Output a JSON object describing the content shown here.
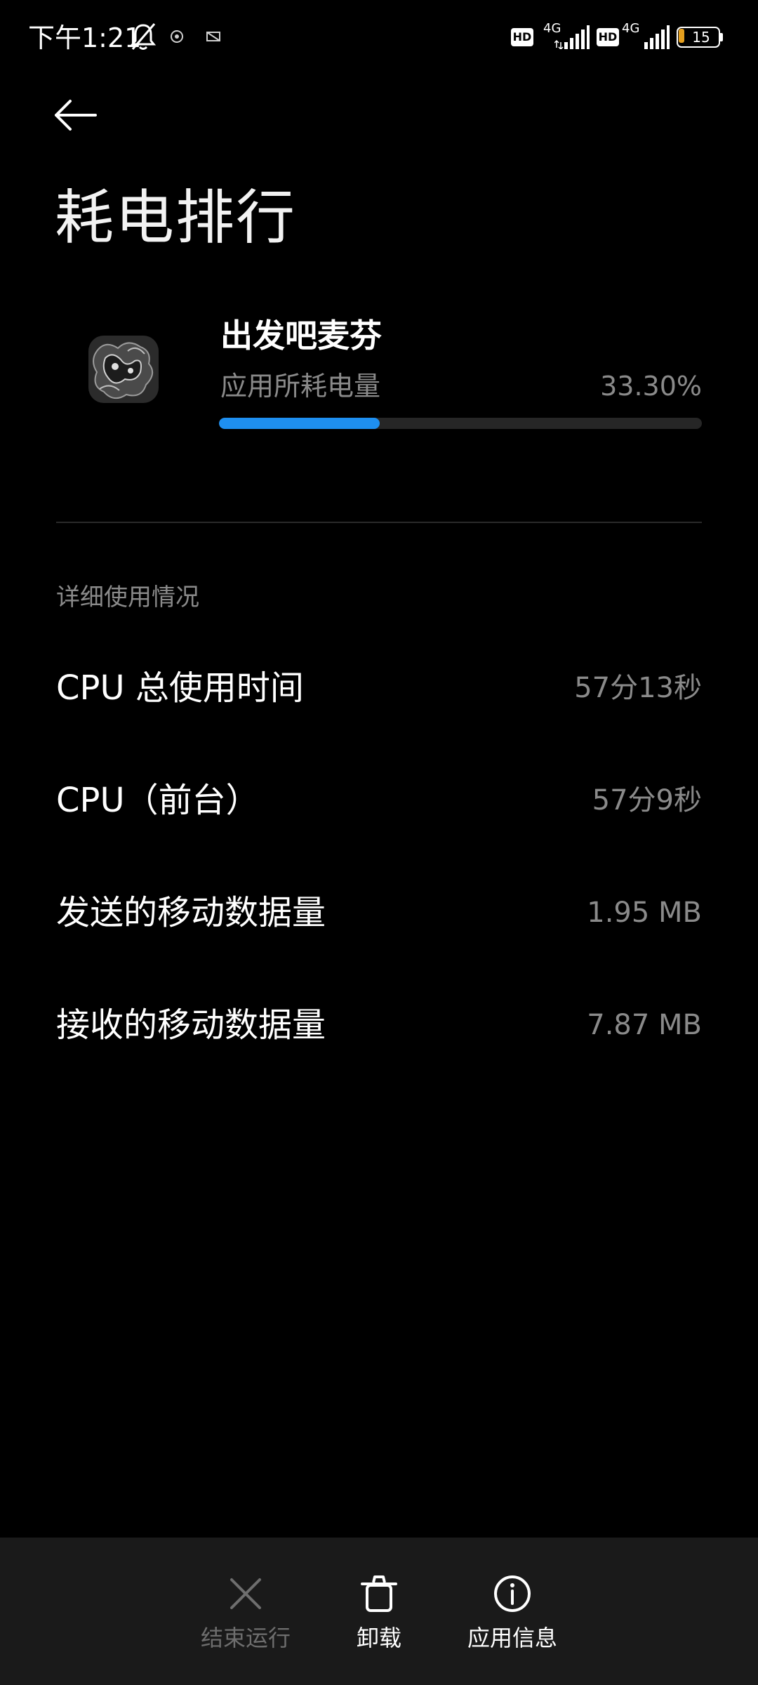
{
  "status_bar": {
    "time": "下午1:21",
    "hd_badges": [
      "HD",
      "HD"
    ],
    "network_labels": [
      "4G",
      "4G"
    ],
    "battery_level": "15",
    "battery_fraction": 0.15,
    "icons": [
      "mute-bell-icon",
      "app-notification-icon",
      "app-notification-icon",
      "signal-icon",
      "signal-icon",
      "battery-icon"
    ]
  },
  "header": {
    "back_icon": "arrow-left-icon",
    "title": "耗电排行"
  },
  "app": {
    "name": "出发吧麦芬",
    "usage_label": "应用所耗电量",
    "usage_value": "33.30%",
    "usage_fraction": 0.333,
    "accent_color": "#1e8ff0"
  },
  "details": {
    "header": "详细使用情况",
    "rows": [
      {
        "label": "CPU 总使用时间",
        "value": "57分13秒"
      },
      {
        "label": "CPU（前台）",
        "value": "57分9秒"
      },
      {
        "label": "发送的移动数据量",
        "value": "1.95 MB"
      },
      {
        "label": "接收的移动数据量",
        "value": "7.87 MB"
      }
    ]
  },
  "bottom_bar": {
    "actions": [
      {
        "label": "结束运行",
        "icon": "close-icon",
        "enabled": false
      },
      {
        "label": "卸载",
        "icon": "trash-icon",
        "enabled": true
      },
      {
        "label": "应用信息",
        "icon": "info-icon",
        "enabled": true
      }
    ]
  }
}
